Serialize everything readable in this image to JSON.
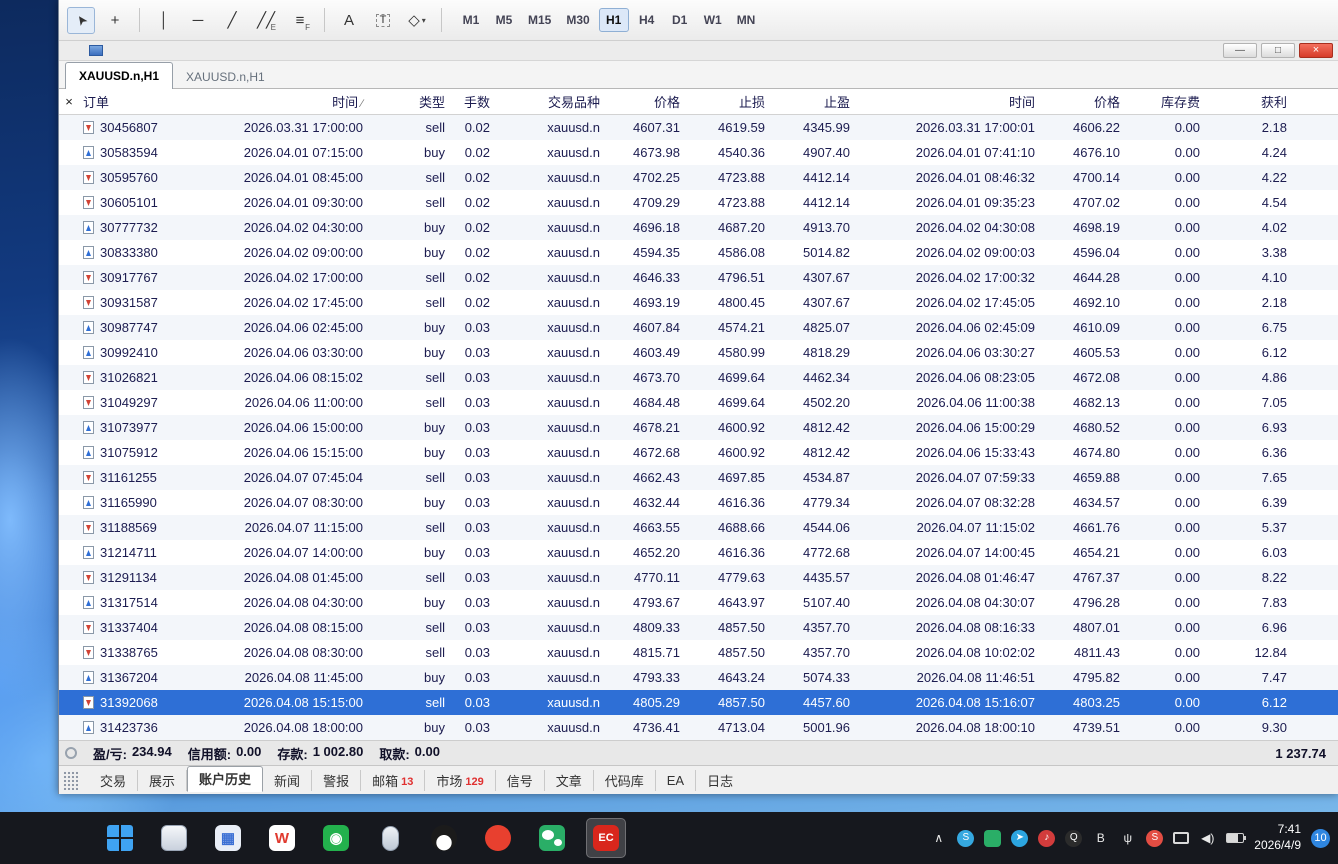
{
  "toolbar": {
    "tools": [
      {
        "name": "cursor-tool-icon",
        "glyph": "➤",
        "cls": "cursor",
        "active": true
      },
      {
        "name": "crosshair-tool-icon",
        "glyph": "+"
      },
      {
        "sep": true
      },
      {
        "name": "vertical-line-tool-icon",
        "glyph": "│"
      },
      {
        "name": "horizontal-line-tool-icon",
        "glyph": "─"
      },
      {
        "name": "trendline-tool-icon",
        "glyph": "╱"
      },
      {
        "name": "channel-tool-icon",
        "glyph": "╱╱",
        "sub": "E"
      },
      {
        "name": "fibonacci-tool-icon",
        "glyph": "≡",
        "sub": "F"
      },
      {
        "sep": true
      },
      {
        "name": "text-tool-icon",
        "glyph": "A"
      },
      {
        "name": "label-tool-icon",
        "glyph": "T",
        "cls": "boxed"
      },
      {
        "name": "shapes-tool-icon",
        "glyph": "◇",
        "caret": true
      },
      {
        "sep": true
      }
    ],
    "timeframes": [
      {
        "label": "M1"
      },
      {
        "label": "M5"
      },
      {
        "label": "M15"
      },
      {
        "label": "M30"
      },
      {
        "label": "H1",
        "active": true
      },
      {
        "label": "H4"
      },
      {
        "label": "D1"
      },
      {
        "label": "W1"
      },
      {
        "label": "MN"
      }
    ]
  },
  "window_buttons": {
    "minimize": "—",
    "restore": "□",
    "close": "×"
  },
  "chart_tabs": [
    {
      "label": "XAUUSD.n,H1",
      "active": true
    },
    {
      "label": "XAUUSD.n,H1",
      "active": false
    }
  ],
  "panel_close": "×",
  "table": {
    "headers": [
      {
        "label": "订单"
      },
      {
        "label": "时间",
        "sort": "∕"
      },
      {
        "label": "类型"
      },
      {
        "label": "手数"
      },
      {
        "label": "交易品种"
      },
      {
        "label": "价格"
      },
      {
        "label": "止损"
      },
      {
        "label": "止盈"
      },
      {
        "label": "时间"
      },
      {
        "label": "价格"
      },
      {
        "label": "库存费"
      },
      {
        "label": "获利"
      }
    ],
    "selected_row": 23,
    "rows": [
      [
        "30456807",
        "2026.03.31 17:00:00",
        "sell",
        "0.02",
        "xauusd.n",
        "4607.31",
        "4619.59",
        "4345.99",
        "2026.03.31 17:00:01",
        "4606.22",
        "0.00",
        "2.18"
      ],
      [
        "30583594",
        "2026.04.01 07:15:00",
        "buy",
        "0.02",
        "xauusd.n",
        "4673.98",
        "4540.36",
        "4907.40",
        "2026.04.01 07:41:10",
        "4676.10",
        "0.00",
        "4.24"
      ],
      [
        "30595760",
        "2026.04.01 08:45:00",
        "sell",
        "0.02",
        "xauusd.n",
        "4702.25",
        "4723.88",
        "4412.14",
        "2026.04.01 08:46:32",
        "4700.14",
        "0.00",
        "4.22"
      ],
      [
        "30605101",
        "2026.04.01 09:30:00",
        "sell",
        "0.02",
        "xauusd.n",
        "4709.29",
        "4723.88",
        "4412.14",
        "2026.04.01 09:35:23",
        "4707.02",
        "0.00",
        "4.54"
      ],
      [
        "30777732",
        "2026.04.02 04:30:00",
        "buy",
        "0.02",
        "xauusd.n",
        "4696.18",
        "4687.20",
        "4913.70",
        "2026.04.02 04:30:08",
        "4698.19",
        "0.00",
        "4.02"
      ],
      [
        "30833380",
        "2026.04.02 09:00:00",
        "buy",
        "0.02",
        "xauusd.n",
        "4594.35",
        "4586.08",
        "5014.82",
        "2026.04.02 09:00:03",
        "4596.04",
        "0.00",
        "3.38"
      ],
      [
        "30917767",
        "2026.04.02 17:00:00",
        "sell",
        "0.02",
        "xauusd.n",
        "4646.33",
        "4796.51",
        "4307.67",
        "2026.04.02 17:00:32",
        "4644.28",
        "0.00",
        "4.10"
      ],
      [
        "30931587",
        "2026.04.02 17:45:00",
        "sell",
        "0.02",
        "xauusd.n",
        "4693.19",
        "4800.45",
        "4307.67",
        "2026.04.02 17:45:05",
        "4692.10",
        "0.00",
        "2.18"
      ],
      [
        "30987747",
        "2026.04.06 02:45:00",
        "buy",
        "0.03",
        "xauusd.n",
        "4607.84",
        "4574.21",
        "4825.07",
        "2026.04.06 02:45:09",
        "4610.09",
        "0.00",
        "6.75"
      ],
      [
        "30992410",
        "2026.04.06 03:30:00",
        "buy",
        "0.03",
        "xauusd.n",
        "4603.49",
        "4580.99",
        "4818.29",
        "2026.04.06 03:30:27",
        "4605.53",
        "0.00",
        "6.12"
      ],
      [
        "31026821",
        "2026.04.06 08:15:02",
        "sell",
        "0.03",
        "xauusd.n",
        "4673.70",
        "4699.64",
        "4462.34",
        "2026.04.06 08:23:05",
        "4672.08",
        "0.00",
        "4.86"
      ],
      [
        "31049297",
        "2026.04.06 11:00:00",
        "sell",
        "0.03",
        "xauusd.n",
        "4684.48",
        "4699.64",
        "4502.20",
        "2026.04.06 11:00:38",
        "4682.13",
        "0.00",
        "7.05"
      ],
      [
        "31073977",
        "2026.04.06 15:00:00",
        "buy",
        "0.03",
        "xauusd.n",
        "4678.21",
        "4600.92",
        "4812.42",
        "2026.04.06 15:00:29",
        "4680.52",
        "0.00",
        "6.93"
      ],
      [
        "31075912",
        "2026.04.06 15:15:00",
        "buy",
        "0.03",
        "xauusd.n",
        "4672.68",
        "4600.92",
        "4812.42",
        "2026.04.06 15:33:43",
        "4674.80",
        "0.00",
        "6.36"
      ],
      [
        "31161255",
        "2026.04.07 07:45:04",
        "sell",
        "0.03",
        "xauusd.n",
        "4662.43",
        "4697.85",
        "4534.87",
        "2026.04.07 07:59:33",
        "4659.88",
        "0.00",
        "7.65"
      ],
      [
        "31165990",
        "2026.04.07 08:30:00",
        "buy",
        "0.03",
        "xauusd.n",
        "4632.44",
        "4616.36",
        "4779.34",
        "2026.04.07 08:32:28",
        "4634.57",
        "0.00",
        "6.39"
      ],
      [
        "31188569",
        "2026.04.07 11:15:00",
        "sell",
        "0.03",
        "xauusd.n",
        "4663.55",
        "4688.66",
        "4544.06",
        "2026.04.07 11:15:02",
        "4661.76",
        "0.00",
        "5.37"
      ],
      [
        "31214711",
        "2026.04.07 14:00:00",
        "buy",
        "0.03",
        "xauusd.n",
        "4652.20",
        "4616.36",
        "4772.68",
        "2026.04.07 14:00:45",
        "4654.21",
        "0.00",
        "6.03"
      ],
      [
        "31291134",
        "2026.04.08 01:45:00",
        "sell",
        "0.03",
        "xauusd.n",
        "4770.11",
        "4779.63",
        "4435.57",
        "2026.04.08 01:46:47",
        "4767.37",
        "0.00",
        "8.22"
      ],
      [
        "31317514",
        "2026.04.08 04:30:00",
        "buy",
        "0.03",
        "xauusd.n",
        "4793.67",
        "4643.97",
        "5107.40",
        "2026.04.08 04:30:07",
        "4796.28",
        "0.00",
        "7.83"
      ],
      [
        "31337404",
        "2026.04.08 08:15:00",
        "sell",
        "0.03",
        "xauusd.n",
        "4809.33",
        "4857.50",
        "4357.70",
        "2026.04.08 08:16:33",
        "4807.01",
        "0.00",
        "6.96"
      ],
      [
        "31338765",
        "2026.04.08 08:30:00",
        "sell",
        "0.03",
        "xauusd.n",
        "4815.71",
        "4857.50",
        "4357.70",
        "2026.04.08 10:02:02",
        "4811.43",
        "0.00",
        "12.84"
      ],
      [
        "31367204",
        "2026.04.08 11:45:00",
        "buy",
        "0.03",
        "xauusd.n",
        "4793.33",
        "4643.24",
        "5074.33",
        "2026.04.08 11:46:51",
        "4795.82",
        "0.00",
        "7.47"
      ],
      [
        "31392068",
        "2026.04.08 15:15:00",
        "sell",
        "0.03",
        "xauusd.n",
        "4805.29",
        "4857.50",
        "4457.60",
        "2026.04.08 15:16:07",
        "4803.25",
        "0.00",
        "6.12"
      ],
      [
        "31423736",
        "2026.04.08 18:00:00",
        "buy",
        "0.03",
        "xauusd.n",
        "4736.41",
        "4713.04",
        "5001.96",
        "2026.04.08 18:00:10",
        "4739.51",
        "0.00",
        "9.30"
      ]
    ]
  },
  "summary": {
    "items": [
      {
        "label": "盈/亏:",
        "value": "234.94"
      },
      {
        "label": "信用额:",
        "value": "0.00"
      },
      {
        "label": "存款:",
        "value": "1 002.80"
      },
      {
        "label": "取款:",
        "value": "0.00"
      }
    ],
    "total": "1 237.74"
  },
  "bottom_tabs": [
    {
      "label": "交易"
    },
    {
      "label": "展示"
    },
    {
      "label": "账户历史",
      "active": true
    },
    {
      "label": "新闻"
    },
    {
      "label": "警报"
    },
    {
      "label": "邮箱",
      "badge": "13"
    },
    {
      "label": "市场",
      "badge": "129"
    },
    {
      "label": "信号"
    },
    {
      "label": "文章"
    },
    {
      "label": "代码库"
    },
    {
      "label": "EA"
    },
    {
      "label": "日志"
    }
  ],
  "taskbar": {
    "apps": [
      {
        "name": "start-button",
        "type": "winlogo"
      },
      {
        "name": "file-explorer-icon",
        "type": "explorer"
      },
      {
        "name": "calculator-icon",
        "type": "tile",
        "glyph": "▦",
        "bg": "#e9eef7",
        "fg": "#3b6fd4"
      },
      {
        "name": "wps-icon",
        "type": "tile",
        "glyph": "W",
        "bg": "#ffffff",
        "fg": "#e03a2f"
      },
      {
        "name": "green-app-icon",
        "type": "tile",
        "glyph": "◉",
        "bg": "#23b14d",
        "fg": "#ffffff"
      },
      {
        "name": "mouse-utility-icon",
        "type": "mouse"
      },
      {
        "name": "qq-icon",
        "type": "qq"
      },
      {
        "name": "red-circle-app-icon",
        "type": "circle",
        "glyph": "",
        "bg": "#e8402f",
        "fg": "#ffffff"
      },
      {
        "name": "wechat-icon",
        "type": "wechat"
      },
      {
        "name": "ec-app-icon",
        "type": "tile",
        "glyph": "EC",
        "bg": "#d9261c",
        "fg": "#ffffff",
        "active": true,
        "small": true
      }
    ],
    "tray": [
      {
        "name": "hidden-icons-chevron",
        "type": "plain",
        "glyph": "∧"
      },
      {
        "name": "skype-icon",
        "type": "circle",
        "glyph": "S",
        "bg": "#35a8e0"
      },
      {
        "name": "wechat-tray-icon",
        "type": "square",
        "glyph": "",
        "bg": "#2aae67"
      },
      {
        "name": "telegram-icon",
        "type": "circle",
        "glyph": "➤",
        "bg": "#2ca5e0"
      },
      {
        "name": "music-app-icon",
        "type": "circle",
        "glyph": "♪",
        "bg": "#d23c3c"
      },
      {
        "name": "qq-tray-icon",
        "type": "circle",
        "glyph": "Q",
        "bg": "#2b2b2b"
      },
      {
        "name": "bluetooth-icon",
        "type": "plain",
        "glyph": "B"
      },
      {
        "name": "usb-icon",
        "type": "plain",
        "glyph": "ψ"
      },
      {
        "name": "stream-app-icon",
        "type": "circle",
        "glyph": "S",
        "bg": "#e34d43"
      },
      {
        "name": "monitor-icon",
        "type": "monitor"
      },
      {
        "name": "volume-icon",
        "type": "plain",
        "glyph": "◀)"
      },
      {
        "name": "battery-icon",
        "type": "battery"
      }
    ],
    "time": "7:41",
    "date": "2026/4/9",
    "badge": "10"
  }
}
